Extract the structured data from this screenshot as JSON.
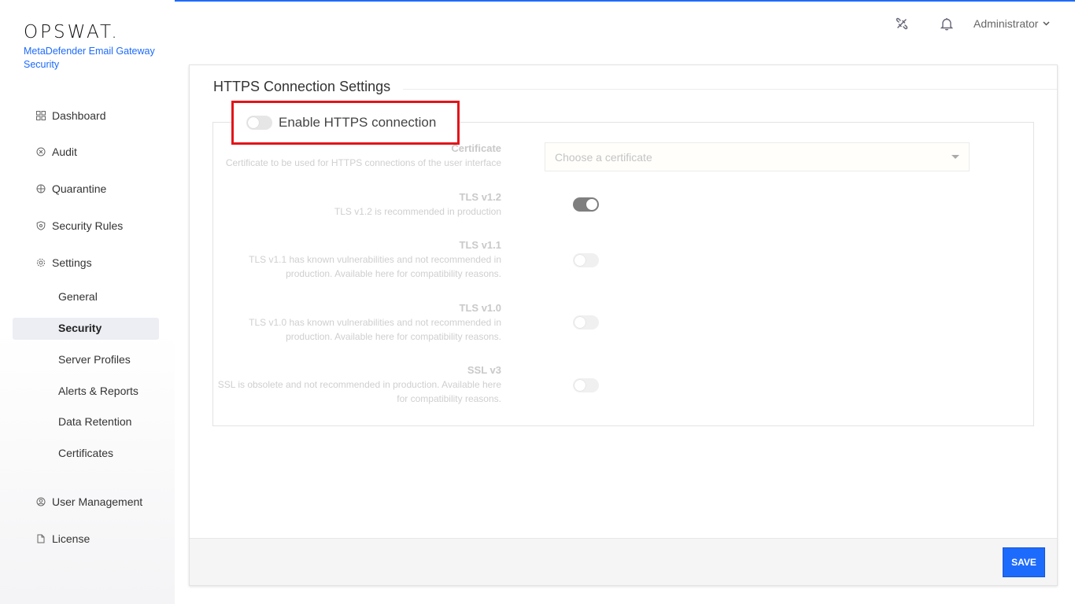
{
  "brand": {
    "logo": "OPSWAT.",
    "product": "MetaDefender Email Gateway Security"
  },
  "header": {
    "user": "Administrator",
    "icons": [
      "disconnect-icon",
      "bell-icon",
      "chevron-down-icon"
    ]
  },
  "sidebar": {
    "items": [
      {
        "label": "Dashboard",
        "icon": "dashboard-icon"
      },
      {
        "label": "Audit",
        "icon": "audit-icon"
      },
      {
        "label": "Quarantine",
        "icon": "quarantine-icon"
      },
      {
        "label": "Security Rules",
        "icon": "shield-icon"
      },
      {
        "label": "Settings",
        "icon": "gear-icon"
      },
      {
        "label": "User Management",
        "icon": "user-management-icon"
      },
      {
        "label": "License",
        "icon": "license-icon"
      }
    ],
    "settings_sub": [
      {
        "label": "General"
      },
      {
        "label": "Security",
        "active": true
      },
      {
        "label": "Server Profiles"
      },
      {
        "label": "Alerts & Reports"
      },
      {
        "label": "Data Retention"
      },
      {
        "label": "Certificates"
      }
    ]
  },
  "card": {
    "title": "HTTPS Connection Settings",
    "enable_label": "Enable HTTPS connection",
    "enable_on": false,
    "certificate": {
      "title": "Certificate",
      "desc": "Certificate to be used for HTTPS connections of the user interface",
      "placeholder": "Choose a certificate"
    },
    "rows": [
      {
        "title": "TLS v1.2",
        "desc1": "TLS v1.2 is recommended in production",
        "desc2": "",
        "on": true
      },
      {
        "title": "TLS v1.1",
        "desc1": "TLS v1.1 has known vulnerabilities and not recommended in",
        "desc2": "production. Available here for compatibility reasons.",
        "on": false
      },
      {
        "title": "TLS v1.0",
        "desc1": "TLS v1.0 has known vulnerabilities and not recommended in",
        "desc2": "production. Available here for compatibility reasons.",
        "on": false
      },
      {
        "title": "SSL v3",
        "desc1": "SSL is obsolete and not recommended in production. Available here",
        "desc2": "for compatibility reasons.",
        "on": false
      }
    ],
    "save_label": "SAVE"
  },
  "colors": {
    "accent": "#1d6bfc",
    "highlight_box": "#e3151a"
  }
}
